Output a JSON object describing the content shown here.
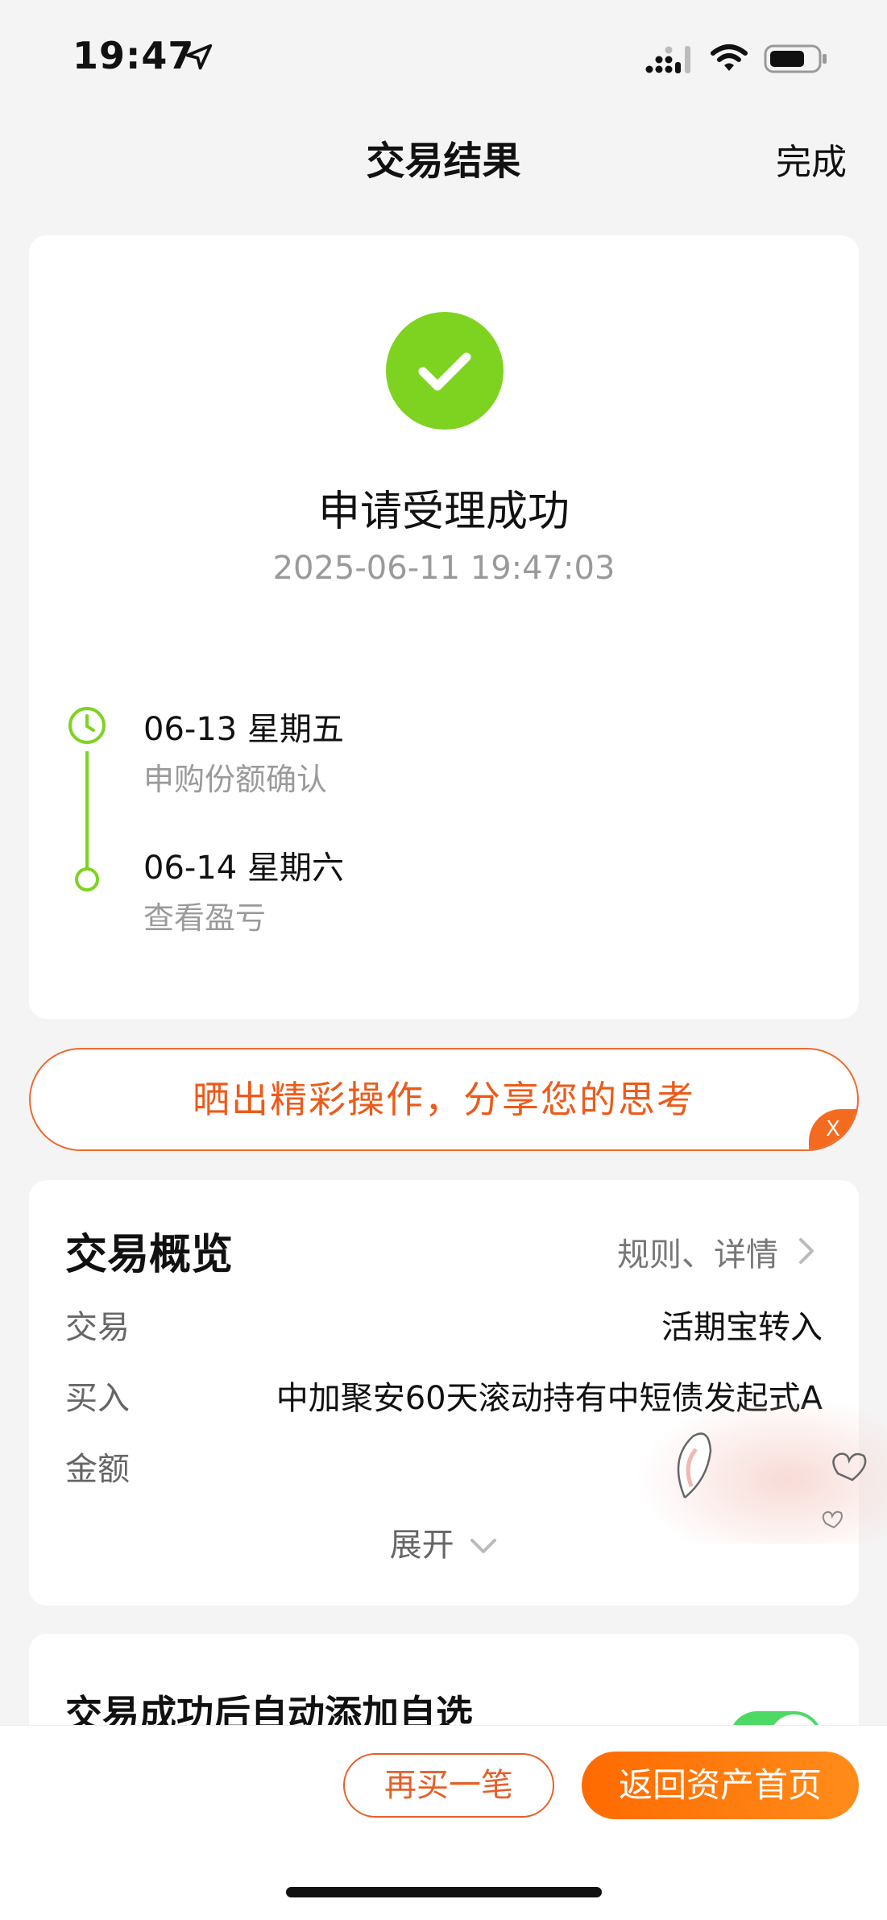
{
  "status_bar": {
    "time": "19:47",
    "icons": [
      "location-arrow-icon",
      "signal-icon",
      "wifi-icon",
      "battery-icon"
    ]
  },
  "nav": {
    "title": "交易结果",
    "done_label": "完成"
  },
  "result": {
    "icon": "success-check-icon",
    "title": "申请受理成功",
    "timestamp": "2025-06-11 19:47:03",
    "timeline": [
      {
        "date": "06-13  星期五",
        "desc": "申购份额确认",
        "icon": "clock-icon"
      },
      {
        "date": "06-14  星期六",
        "desc": "查看盈亏",
        "icon": "dot-icon"
      }
    ]
  },
  "share_banner": {
    "text": "晒出精彩操作，分享您的思考",
    "close_label": "X"
  },
  "overview": {
    "title": "交易概览",
    "rules_link": "规则、详情",
    "rows": [
      {
        "label": "交易",
        "value": "活期宝转入"
      },
      {
        "label": "买入",
        "value": "中加聚安60天滚动持有中短债发起式A"
      },
      {
        "label": "金额",
        "value": ""
      }
    ],
    "expand_label": "展开"
  },
  "auto_add": {
    "title": "交易成功后自动添加自选",
    "toggle_on": true
  },
  "bottom_actions": {
    "buy_again_label": "再买一笔",
    "back_home_label": "返回资产首页"
  },
  "colors": {
    "success_green": "#7ed321",
    "accent_orange": "#ff6a00",
    "toggle_green": "#4cd964"
  }
}
